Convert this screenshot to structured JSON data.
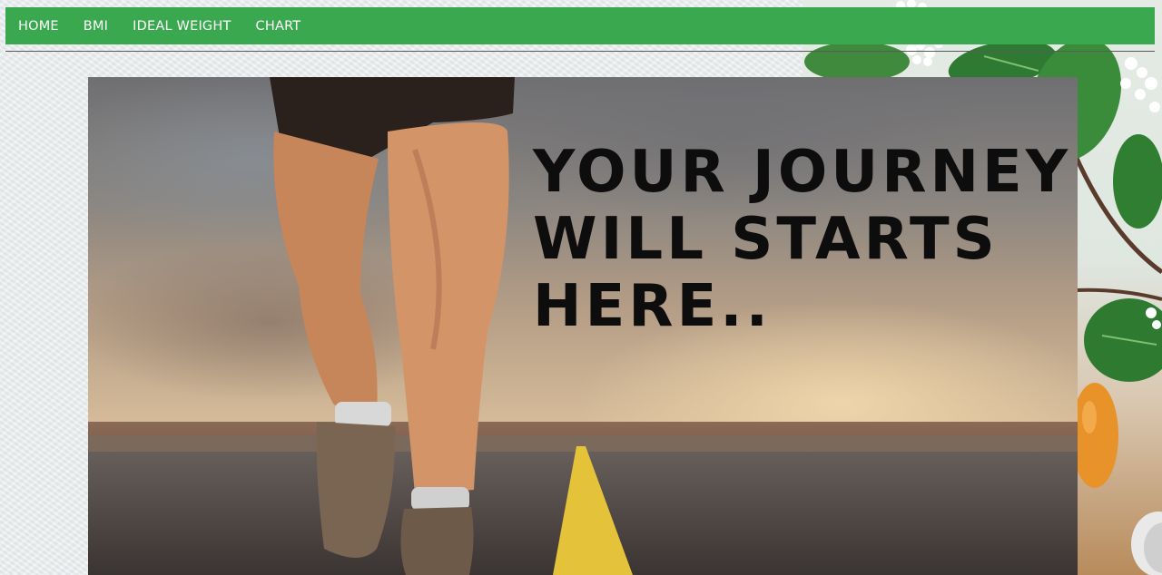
{
  "nav": {
    "items": [
      {
        "label": "HOME"
      },
      {
        "label": "BMI"
      },
      {
        "label": "IDEAL WEIGHT"
      },
      {
        "label": "CHART"
      }
    ],
    "bar_color": "#3aa84f"
  },
  "hero": {
    "lines": [
      "YOUR JOURNEY",
      "WILL STARTS",
      "HERE.."
    ],
    "text_color": "#0d0d0d",
    "road_stripe_color": "#e4c23a"
  },
  "decor": {
    "icons": [
      "leaf-icon",
      "flower-icon",
      "orange-icon"
    ]
  }
}
